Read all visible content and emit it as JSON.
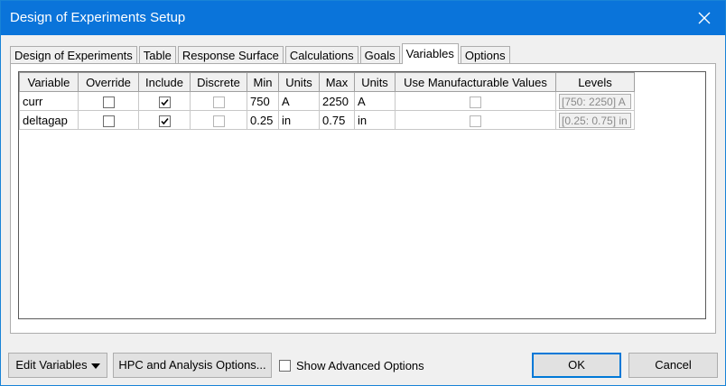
{
  "window": {
    "title": "Design of Experiments Setup"
  },
  "tabs": [
    {
      "label": "Design of Experiments",
      "active": false
    },
    {
      "label": "Table",
      "active": false
    },
    {
      "label": "Response Surface",
      "active": false
    },
    {
      "label": "Calculations",
      "active": false
    },
    {
      "label": "Goals",
      "active": false
    },
    {
      "label": "Variables",
      "active": true
    },
    {
      "label": "Options",
      "active": false
    }
  ],
  "variables_table": {
    "columns": [
      "Variable",
      "Override",
      "Include",
      "Discrete",
      "Min",
      "Units",
      "Max",
      "Units",
      "Use Manufacturable Values",
      "Levels"
    ],
    "rows": [
      {
        "variable": "curr",
        "override": false,
        "include": true,
        "discrete": false,
        "min": "750",
        "min_units": "A",
        "max": "2250",
        "max_units": "A",
        "use_manufacturable": false,
        "levels": "[750: 2250] A"
      },
      {
        "variable": "deltagap",
        "override": false,
        "include": true,
        "discrete": false,
        "min": "0.25",
        "min_units": "in",
        "max": "0.75",
        "max_units": "in",
        "use_manufacturable": false,
        "levels": "[0.25: 0.75] in"
      }
    ]
  },
  "footer": {
    "edit_variables": "Edit Variables",
    "hpc_options": "HPC and Analysis Options...",
    "show_advanced": "Show Advanced Options",
    "show_advanced_checked": false,
    "ok": "OK",
    "cancel": "Cancel"
  },
  "colors": {
    "titlebar": "#0a74da",
    "default_button_border": "#0078d7"
  }
}
